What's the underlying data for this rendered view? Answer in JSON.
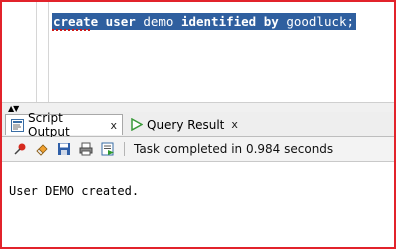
{
  "editor": {
    "statement_parts": [
      {
        "text": "create user",
        "bold": true
      },
      {
        "text": " demo ",
        "bold": false
      },
      {
        "text": "identified by",
        "bold": true
      },
      {
        "text": " goodluck;",
        "bold": false
      }
    ]
  },
  "tabs": [
    {
      "label": "Script Output",
      "close": "x",
      "icon": "script-output-icon",
      "active": true
    },
    {
      "label": "Query Result",
      "close": "x",
      "icon": "play-icon",
      "active": false
    }
  ],
  "toolbar": {
    "icons": [
      "pin-icon",
      "eraser-icon",
      "save-icon",
      "print-icon",
      "run-script-icon"
    ],
    "status": "Task completed in 0.984 seconds"
  },
  "output": {
    "text": "User DEMO created."
  },
  "colors": {
    "frame_border": "#e2232b",
    "selection": "#2f5f9f"
  }
}
